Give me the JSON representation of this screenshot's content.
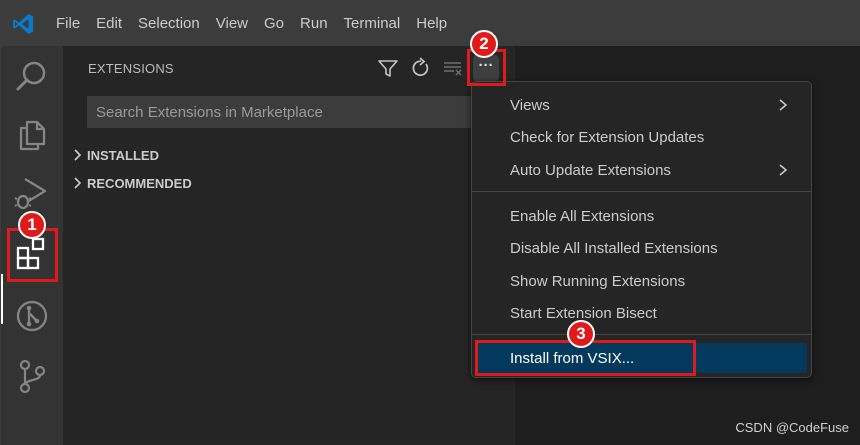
{
  "titlebar": {
    "menu": [
      "File",
      "Edit",
      "Selection",
      "View",
      "Go",
      "Run",
      "Terminal",
      "Help"
    ],
    "logo_icon": "vscode-logo-icon",
    "background": "#3c3c3c"
  },
  "activitybar": {
    "icons": [
      "search-icon",
      "explorer-files-icon",
      "run-debug-icon",
      "extensions-icon",
      "remote-explorer-icon",
      "source-control-icon"
    ],
    "active": "extensions-icon"
  },
  "sidebar": {
    "title": "EXTENSIONS",
    "actions": [
      "filter-icon",
      "refresh-icon",
      "clear-results-icon",
      "more-actions-icon"
    ],
    "more_actions_label": "···",
    "search": {
      "placeholder": "Search Extensions in Marketplace",
      "value": ""
    },
    "sections": [
      {
        "label": "INSTALLED"
      },
      {
        "label": "RECOMMENDED"
      }
    ]
  },
  "context_menu": {
    "items": [
      {
        "label": "Views",
        "submenu": true
      },
      {
        "label": "Check for Extension Updates",
        "submenu": false
      },
      {
        "label": "Auto Update Extensions",
        "submenu": true
      },
      {
        "label": "Enable All Extensions",
        "submenu": false
      },
      {
        "label": "Disable All Installed Extensions",
        "submenu": false
      },
      {
        "label": "Show Running Extensions",
        "submenu": false
      },
      {
        "label": "Start Extension Bisect",
        "submenu": false
      },
      {
        "label": "Install from VSIX...",
        "submenu": false,
        "highlighted": true
      }
    ]
  },
  "annotations": [
    {
      "number": "1",
      "target": "extensions-icon"
    },
    {
      "number": "2",
      "target": "more-actions-button"
    },
    {
      "number": "3",
      "target": "install-from-vsix"
    }
  ],
  "watermark": "CSDN @CodeFuse",
  "colors": {
    "accent_blue": "#0078d4",
    "annotation_red": "#e01a1a",
    "menu_highlight": "#04395e"
  }
}
